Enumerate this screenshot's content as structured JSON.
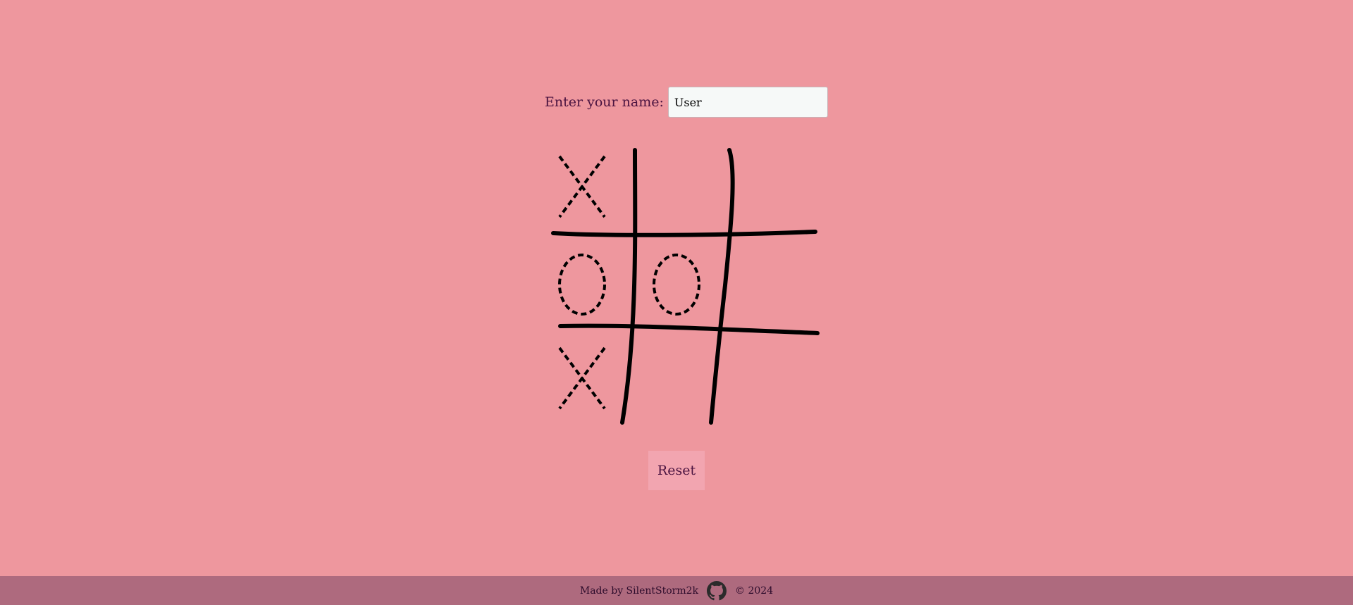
{
  "form": {
    "name_label": "Enter your name:",
    "name_value": "User"
  },
  "board": {
    "cells": [
      "X",
      "",
      "",
      "O",
      "O",
      "",
      "X",
      "",
      ""
    ]
  },
  "controls": {
    "reset_label": "Reset"
  },
  "footer": {
    "made_by": "Made by SilentStorm2k",
    "icon": "github-icon",
    "copyright": "© 2024"
  },
  "colors": {
    "background": "#ee979e",
    "footer_bg": "#ae6a7e",
    "text": "#4a1340",
    "marks": "#000000"
  }
}
